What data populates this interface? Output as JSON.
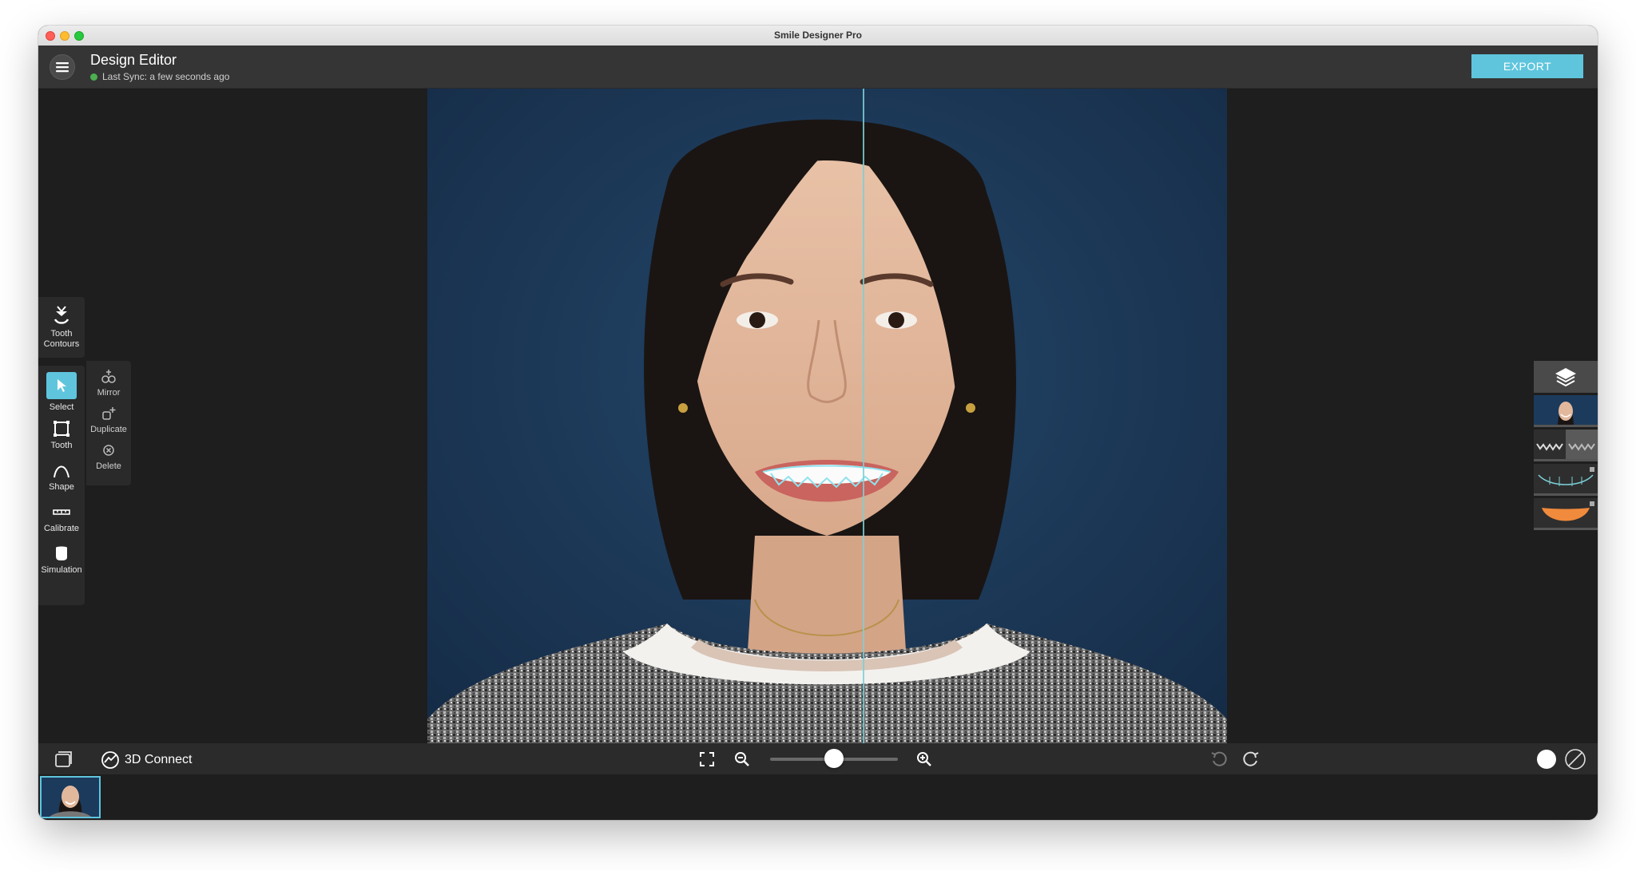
{
  "window": {
    "title": "Smile Designer Pro"
  },
  "header": {
    "title": "Design Editor",
    "sync_status": "Last Sync: a few seconds ago",
    "export_label": "EXPORT"
  },
  "tools": {
    "tooth_contours": "Tooth\nContours",
    "select": "Select",
    "tooth": "Tooth",
    "shape": "Shape",
    "calibrate": "Calibrate",
    "simulation": "Simulation",
    "mirror": "Mirror",
    "duplicate": "Duplicate",
    "delete": "Delete"
  },
  "bottom": {
    "connect_label": "3D Connect",
    "zoom_level": 0.5
  },
  "colors": {
    "accent": "#5fc5dd",
    "midline": "#7ccfd6",
    "sync_ok": "#4caf50",
    "gum_layer": "#f08a3c"
  },
  "icons": [
    "menu-icon",
    "tooth-contours-icon",
    "cursor-icon",
    "tooth-outline-icon",
    "shape-curve-icon",
    "ruler-icon",
    "tooth-simulation-icon",
    "mirror-icon",
    "duplicate-icon",
    "delete-icon",
    "layers-icon",
    "gallery-icon",
    "3d-connect-icon",
    "fit-screen-icon",
    "zoom-out-icon",
    "zoom-in-icon",
    "undo-icon",
    "redo-icon",
    "circle-toggle-icon",
    "no-fill-icon"
  ]
}
